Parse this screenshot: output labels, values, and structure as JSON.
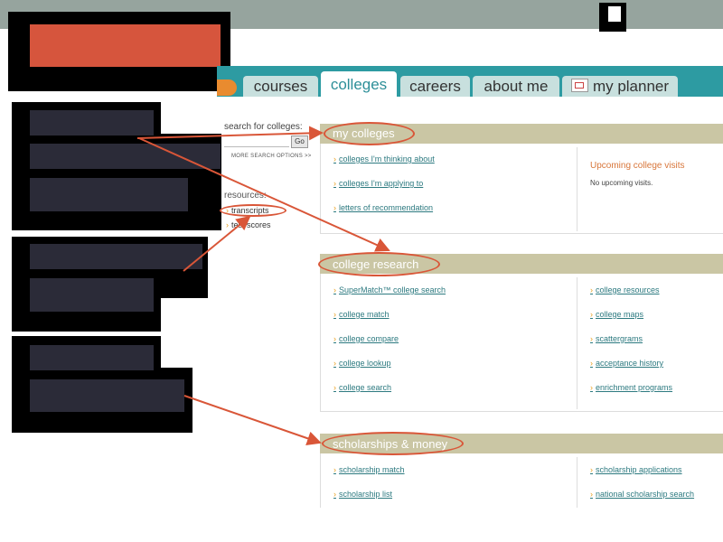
{
  "tabs": [
    {
      "label": "courses"
    },
    {
      "label": "colleges"
    },
    {
      "label": "careers"
    },
    {
      "label": "about me"
    },
    {
      "label": "my planner"
    }
  ],
  "search": {
    "label": "search for colleges:",
    "go_label": "Go",
    "more_options": "MORE SEARCH OPTIONS >>"
  },
  "resources": {
    "label": "resources:",
    "items": [
      "transcripts",
      "test scores"
    ]
  },
  "my_colleges": {
    "title": "my colleges",
    "links": [
      "colleges I'm thinking about",
      "colleges I'm applying to",
      "letters of recommendation"
    ],
    "upcoming_title": "Upcoming college visits",
    "upcoming_none": "No upcoming visits."
  },
  "college_research": {
    "title": "college research",
    "left_links": [
      "SuperMatch™ college search",
      "college match",
      "college compare",
      "college lookup",
      "college search"
    ],
    "right_links": [
      "college resources",
      "college maps",
      "scattergrams",
      "acceptance history",
      "enrichment programs"
    ]
  },
  "scholarships": {
    "title": "scholarships & money",
    "left_links": [
      "scholarship match",
      "scholarship list"
    ],
    "right_links": [
      "scholarship applications",
      "national scholarship search"
    ]
  },
  "colors": {
    "accent_teal": "#2d9ba2",
    "annotation_red": "#d95638",
    "section_header": "#cac6a4",
    "link_orange": "#e8a020"
  }
}
